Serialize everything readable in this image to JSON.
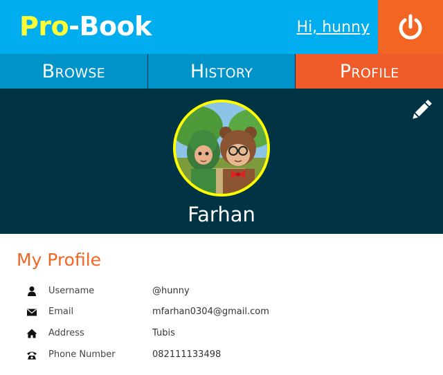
{
  "header": {
    "logo_part1": "Pro",
    "logo_part2": "-Book",
    "greeting": "Hi, hunny",
    "logout_icon": "power-icon"
  },
  "nav": {
    "tabs": [
      {
        "label": "Browse",
        "active": false
      },
      {
        "label": "History",
        "active": false
      },
      {
        "label": "Profile",
        "active": true
      }
    ]
  },
  "profile": {
    "edit_icon": "pencil-icon",
    "avatar_icon": "cartoon-avatar",
    "name": "Farhan"
  },
  "details": {
    "title": "My Profile",
    "rows": [
      {
        "icon": "user-icon",
        "label": "Username",
        "value": "@hunny"
      },
      {
        "icon": "envelope-icon",
        "label": "Email",
        "value": "mfarhan0304@gmail.com"
      },
      {
        "icon": "home-icon",
        "label": "Address",
        "value": "Tubis"
      },
      {
        "icon": "phone-icon",
        "label": "Phone Number",
        "value": "082111133498"
      }
    ]
  },
  "colors": {
    "header": "#00aeef",
    "accent": "#f26522",
    "nav": "#0093c9",
    "banner": "#003344",
    "logo_yellow": "#ffff33"
  }
}
